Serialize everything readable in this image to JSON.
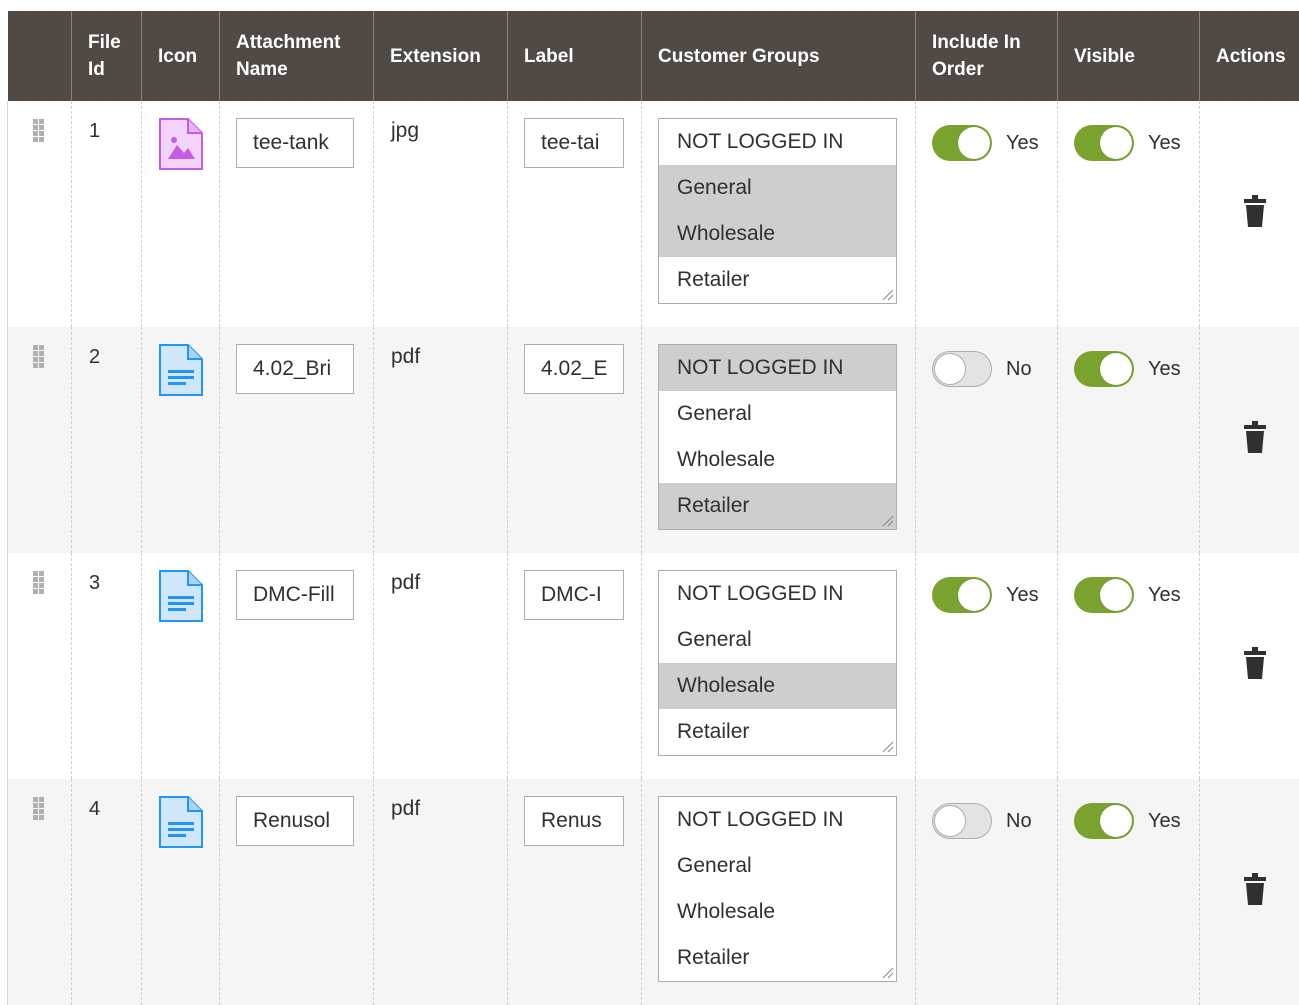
{
  "header": {
    "drag": "",
    "file_id": "File Id",
    "icon": "Icon",
    "attachment_name": "Attachment Name",
    "extension": "Extension",
    "label": "Label",
    "customer_groups": "Customer Groups",
    "include_in_order": "Include In Order",
    "visible": "Visible",
    "actions": "Actions"
  },
  "customer_group_options": [
    "NOT LOGGED IN",
    "General",
    "Wholesale",
    "Retailer"
  ],
  "colors": {
    "header_bg": "#514943",
    "toggle_on": "#79a22e",
    "selected_option": "#cecece",
    "image_icon": "#c45ce6",
    "doc_icon": "#2196f3"
  },
  "rows": [
    {
      "file_id": "1",
      "icon": "image-file-icon",
      "attachment_name": "tee-tank",
      "extension": "jpg",
      "label": "tee-tai",
      "groups_selected": [
        false,
        true,
        true,
        false
      ],
      "include_in_order": {
        "on": true,
        "text": "Yes"
      },
      "visible": {
        "on": true,
        "text": "Yes"
      }
    },
    {
      "file_id": "2",
      "icon": "document-file-icon",
      "attachment_name": "4.02_Bri",
      "extension": "pdf",
      "label": "4.02_E",
      "groups_selected": [
        true,
        false,
        false,
        true
      ],
      "include_in_order": {
        "on": false,
        "text": "No"
      },
      "visible": {
        "on": true,
        "text": "Yes"
      }
    },
    {
      "file_id": "3",
      "icon": "document-file-icon",
      "attachment_name": "DMC-Fill",
      "extension": "pdf",
      "label": "DMC-I",
      "groups_selected": [
        false,
        false,
        true,
        false
      ],
      "include_in_order": {
        "on": true,
        "text": "Yes"
      },
      "visible": {
        "on": true,
        "text": "Yes"
      }
    },
    {
      "file_id": "4",
      "icon": "document-file-icon",
      "attachment_name": "Renusol",
      "extension": "pdf",
      "label": "Renus",
      "groups_selected": [
        false,
        false,
        false,
        false
      ],
      "include_in_order": {
        "on": false,
        "text": "No"
      },
      "visible": {
        "on": true,
        "text": "Yes"
      }
    }
  ]
}
